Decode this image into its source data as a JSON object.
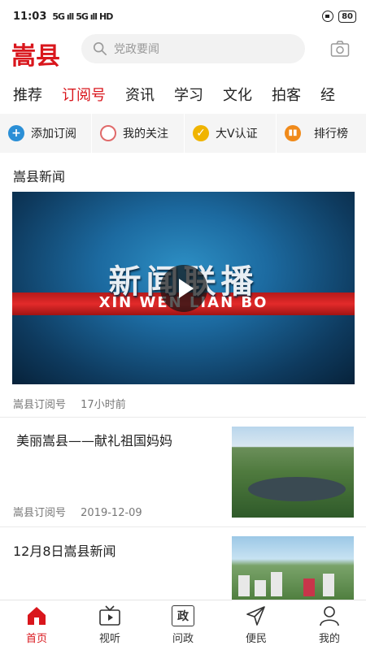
{
  "status": {
    "time": "11:03",
    "sig1": "5G ıll",
    "sig2": "5G ıll",
    "hd": "HD",
    "battery": "80"
  },
  "header": {
    "logo": "嵩县",
    "search_placeholder": "党政要闻"
  },
  "tabs": [
    {
      "label": "推荐"
    },
    {
      "label": "订阅号"
    },
    {
      "label": "资讯"
    },
    {
      "label": "学习"
    },
    {
      "label": "文化"
    },
    {
      "label": "拍客"
    },
    {
      "label": "经"
    }
  ],
  "actions": [
    {
      "label": "添加订阅",
      "color": "#2b8fd6"
    },
    {
      "label": "我的关注",
      "color": "#e06a6a"
    },
    {
      "label": "大V认证",
      "color": "#f0b400"
    },
    {
      "label": "排行榜",
      "color": "#f08a1a"
    }
  ],
  "main": {
    "section_title": "嵩县新闻",
    "video": {
      "title_cn": "新闻联播",
      "title_en": "XIN WEN LIAN BO",
      "source": "嵩县订阅号",
      "time": "17小时前"
    },
    "articles": [
      {
        "title": "美丽嵩县——献礼祖国妈妈",
        "source": "嵩县订阅号",
        "date": "2019-12-09"
      },
      {
        "title": "12月8日嵩县新闻"
      }
    ]
  },
  "nav": [
    {
      "label": "首页"
    },
    {
      "label": "视听"
    },
    {
      "label": "问政",
      "icon_text": "政"
    },
    {
      "label": "便民"
    },
    {
      "label": "我的"
    }
  ],
  "colors": {
    "brand": "#d9161c"
  }
}
